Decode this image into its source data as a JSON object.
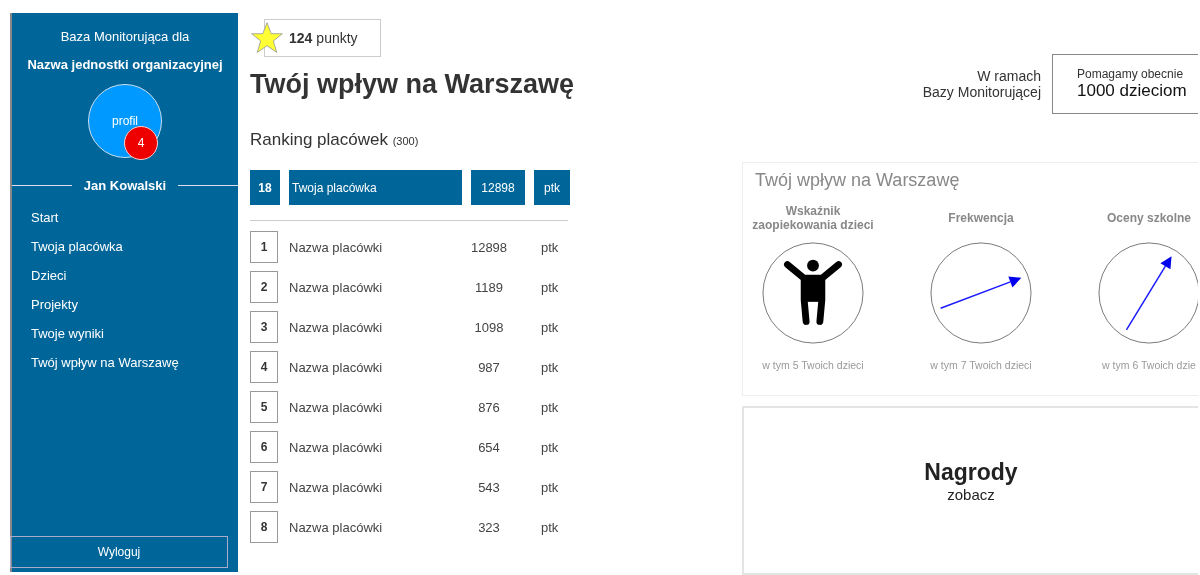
{
  "sidebar": {
    "subtitle": "Baza Monitorująca dla",
    "org_name": "Nazwa jednostki organizacyjnej",
    "profile": {
      "label": "profil",
      "badge": "4"
    },
    "user": "Jan Kowalski",
    "items": [
      {
        "label": "Start"
      },
      {
        "label": "Twoja placówka"
      },
      {
        "label": "Dzieci"
      },
      {
        "label": "Projekty"
      },
      {
        "label": "Twoje wyniki"
      },
      {
        "label": "Twój wpływ na Warszawę"
      }
    ],
    "logout": "Wyloguj"
  },
  "points": {
    "value": "124",
    "unit": "punkty"
  },
  "title": "Twój wpływ na Warszawę",
  "context": {
    "line1": "W ramach",
    "line2": "Bazy Monitorującej",
    "help_label": "Pomagamy obecnie",
    "help_value": "1000 dzieciom"
  },
  "ranking": {
    "title": "Ranking placówek",
    "count": "(300)",
    "own": {
      "rank": "18",
      "name": "Twoja placówka",
      "points": "12898",
      "unit": "ptk"
    },
    "rows": [
      {
        "rank": "1",
        "name": "Nazwa placówki",
        "points": "12898",
        "unit": "ptk"
      },
      {
        "rank": "2",
        "name": "Nazwa placówki",
        "points": "1189",
        "unit": "ptk"
      },
      {
        "rank": "3",
        "name": "Nazwa placówki",
        "points": "1098",
        "unit": "ptk"
      },
      {
        "rank": "4",
        "name": "Nazwa placówki",
        "points": "987",
        "unit": "ptk"
      },
      {
        "rank": "5",
        "name": "Nazwa placówki",
        "points": "876",
        "unit": "ptk"
      },
      {
        "rank": "6",
        "name": "Nazwa placówki",
        "points": "654",
        "unit": "ptk"
      },
      {
        "rank": "7",
        "name": "Nazwa placówki",
        "points": "543",
        "unit": "ptk"
      },
      {
        "rank": "8",
        "name": "Nazwa placówki",
        "points": "323",
        "unit": "ptk"
      }
    ]
  },
  "impact": {
    "title": "Twój wpływ na Warszawę",
    "indicators": [
      {
        "kind": "figure",
        "label": "Wskaźnik zaopiekowania dzieci",
        "note": "w tym 5 Twoich dzieci"
      },
      {
        "kind": "shallow",
        "label": "Frekwencja",
        "note": "w tym 7 Twoich dzieci"
      },
      {
        "kind": "steep",
        "label": "Oceny szkolne",
        "note": "w tym 6 Twoich dzie"
      }
    ]
  },
  "awards": {
    "title": "Nagrody",
    "link": "zobacz"
  }
}
